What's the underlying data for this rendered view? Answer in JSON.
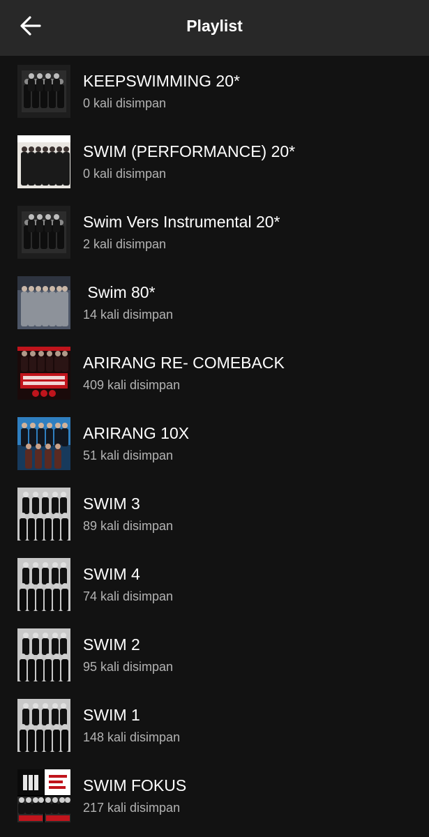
{
  "header": {
    "title": "Playlist",
    "back_icon": "arrow-left-icon"
  },
  "colors": {
    "background": "#121212",
    "header": "#282828",
    "primary_text": "#ffffff",
    "secondary_text": "#b3b3b3",
    "accent_red": "#c0141c"
  },
  "playlists": [
    {
      "title": "KEEPSWIMMING 20*",
      "saves": "0 kali disimpan",
      "cover": "bw-group-collage"
    },
    {
      "title": "SWIM (PERFORMANCE) 20*",
      "saves": "0 kali disimpan",
      "cover": "stage-group-light"
    },
    {
      "title": "Swim Vers Instrumental 20*",
      "saves": "2 kali disimpan",
      "cover": "bw-group-collage"
    },
    {
      "title": " Swim 80*",
      "saves": "14 kali disimpan",
      "cover": "group-suits-grey"
    },
    {
      "title": "ARIRANG RE- COMEBACK",
      "saves": "409 kali disimpan",
      "cover": "arirang-red-poster"
    },
    {
      "title": "ARIRANG 10X",
      "saves": "51 kali disimpan",
      "cover": "group-blue-sky"
    },
    {
      "title": "SWIM 3",
      "saves": "89 kali disimpan",
      "cover": "bw-group-black-outfits"
    },
    {
      "title": "SWIM 4",
      "saves": "74 kali disimpan",
      "cover": "bw-group-black-outfits"
    },
    {
      "title": "SWIM 2",
      "saves": "95 kali disimpan",
      "cover": "bw-group-black-outfits"
    },
    {
      "title": "SWIM 1",
      "saves": "148 kali disimpan",
      "cover": "bw-group-black-outfits"
    },
    {
      "title": "SWIM FOKUS",
      "saves": "217 kali disimpan",
      "cover": "four-image-mosaic"
    }
  ]
}
